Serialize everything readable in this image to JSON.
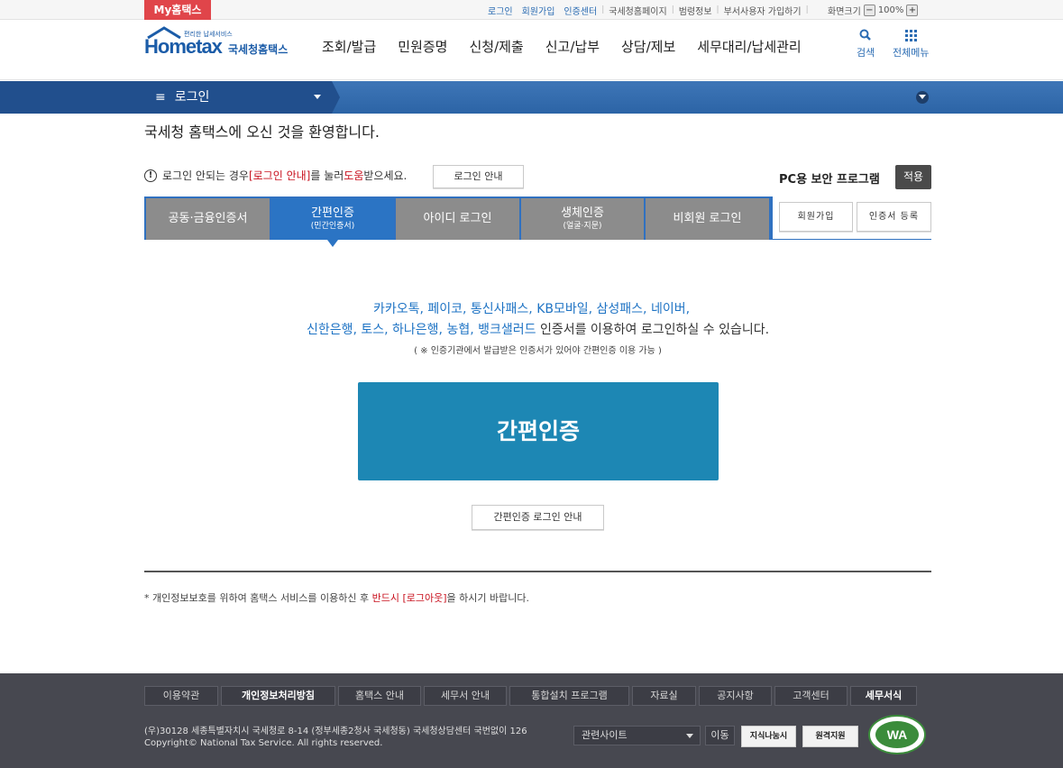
{
  "topbar": {
    "my_tab": "My홈택스",
    "links": [
      "로그인",
      "회원가입",
      "인증센터",
      "국세청홈페이지",
      "범령정보",
      "부서사용자 가입하기",
      "화면크기"
    ],
    "zoom_out": "−",
    "zoom_level": "100%",
    "zoom_in": "+"
  },
  "header": {
    "logo_top_text": "편리한 납세서비스",
    "logo_brand": "Hometax",
    "logo_name": "국세청홈택스",
    "nav": [
      "조회/발급",
      "민원증명",
      "신청/제출",
      "신고/납부",
      "상담/제보",
      "세무대리/납세관리"
    ],
    "search_label": "검색",
    "allmenu_label": "전체메뉴"
  },
  "bluebar": {
    "menu_label": "로그인"
  },
  "welcome": "국세청 홈택스에 오신 것을 환영합니다.",
  "notice": {
    "icon": "!",
    "text_before": "로그인 안되는 경우 ",
    "highlight1": "[로그인 안내]",
    "text_mid": "를 눌러 ",
    "highlight2": "도움",
    "text_after": "받으세요.",
    "guide_button": "로그인 안내"
  },
  "security": {
    "label": "PC용 보안 프로그램",
    "apply_button": "적용"
  },
  "tabs": [
    {
      "label": "공동·금융인증서",
      "sub": ""
    },
    {
      "label": "간편인증",
      "sub": "(민간인증서)"
    },
    {
      "label": "아이디 로그인",
      "sub": ""
    },
    {
      "label": "생체인증",
      "sub": "(얼굴·지문)"
    },
    {
      "label": "비회원 로그인",
      "sub": ""
    }
  ],
  "side_buttons": {
    "signup": "회원가입",
    "cert_register": "인증서 등록"
  },
  "info": {
    "line1": "카카오톡, 페이코, 통신사패스, KB모바일, 삼성패스, 네이버,",
    "line2_blue": "신한은행, 토스, 하나은행, 농협, 뱅크샐러드",
    "line2_rest": " 인증서를 이용하여 로그인하실 수 있습니다.",
    "line3": "( ※ 인증기관에서 발급받은 인증서가 있어야 간편인증 이용 가능 )"
  },
  "main_button": "간편인증",
  "simple_guide_button": "간편인증 로그인 안내",
  "logout_note": {
    "bullet": "*",
    "before": " 개인정보보호를 위하여 홈택스 서비스를 이용하신 후 ",
    "highlight": "반드시 [로그아웃]",
    "after": "을 하시기 바랍니다."
  },
  "footer": {
    "links": [
      {
        "label": "이용약관",
        "strong": false
      },
      {
        "label": "개인정보처리방침",
        "strong": true
      },
      {
        "label": "홈택스 안내",
        "strong": false
      },
      {
        "label": "세무서 안내",
        "strong": false
      },
      {
        "label": "통합설치 프로그램",
        "strong": false
      },
      {
        "label": "자료실",
        "strong": false
      },
      {
        "label": "공지사항",
        "strong": false
      },
      {
        "label": "고객센터",
        "strong": false
      },
      {
        "label": "세무서식",
        "strong": true
      }
    ],
    "address": "(우)30128 세종특별자치시 국세청로 8-14 (정부세종2청사 국세청동) 국세청상담센터 국번없이 126",
    "copyright": "Copyright© National Tax Service. All rights reserved.",
    "related_select": "관련사이트",
    "go_button": "이동",
    "badge1": "지식나눔시",
    "badge2": "원격지원",
    "wa_text": "WA"
  },
  "colors": {
    "accent_red": "#e0454a",
    "primary_blue": "#2b74c4",
    "big_button": "#1d87b4",
    "footer_bg": "#474850"
  }
}
